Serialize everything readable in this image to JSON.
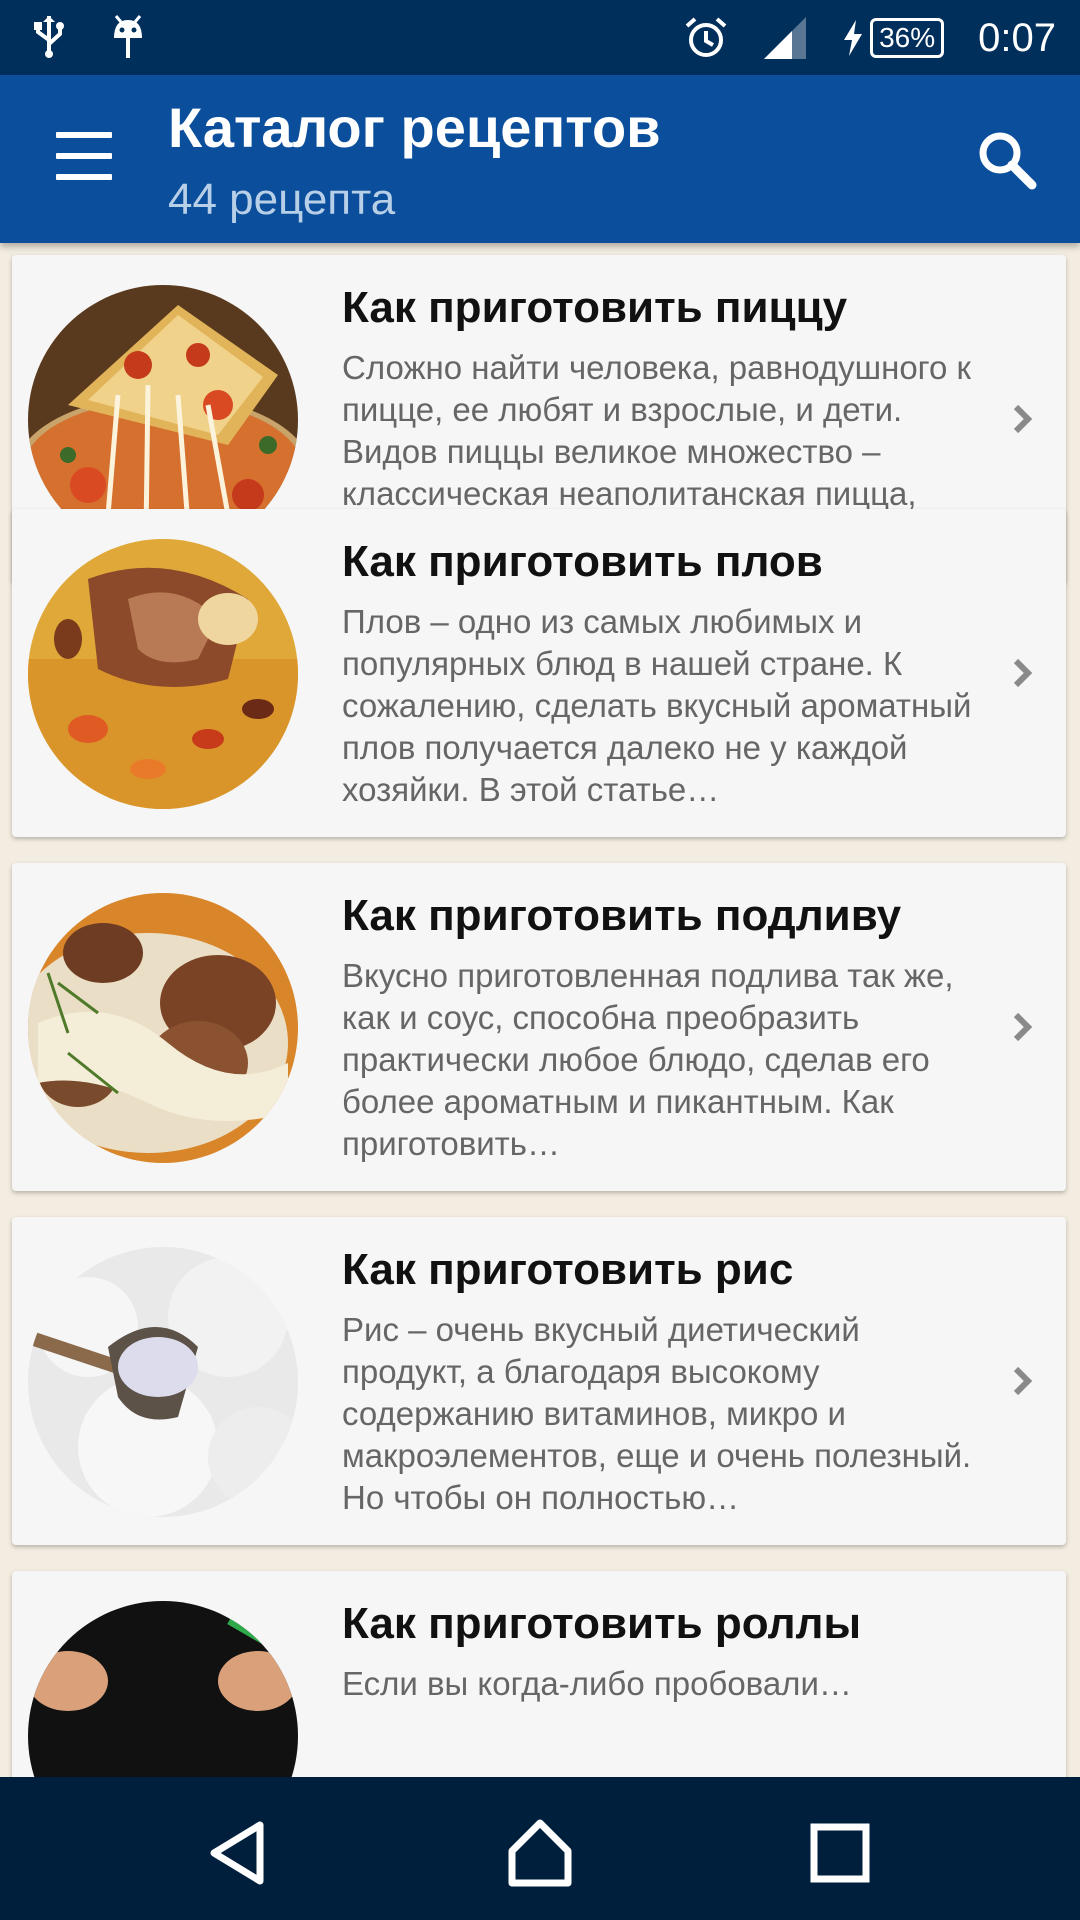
{
  "status_bar": {
    "time": "0:07",
    "battery": "36%",
    "icons": [
      "usb-icon",
      "android-debug-icon",
      "alarm-icon",
      "signal-icon",
      "charging-icon",
      "battery-icon"
    ]
  },
  "app_bar": {
    "title": "Каталог рецептов",
    "subtitle": "44 рецепта",
    "menu_icon": "hamburger-menu-icon",
    "search_icon": "search-icon",
    "color": "#0b4f9c"
  },
  "recipes": [
    {
      "title": "Как приготовить пиццу",
      "description": "Сложно найти человека, равнодушного к пицце, ее любят и взрослые, и дети. Видов пиццы великое множество – классическая неаполитанская пицца, пицца…",
      "image": "pizza-image"
    },
    {
      "title": "Как приготовить плов",
      "description": "Плов – одно из самых любимых и популярных блюд в нашей стране. К сожалению, сделать вкусный ароматный плов получается далеко не у каждой хозяйки. В этой статье…",
      "image": "pilaf-image"
    },
    {
      "title": "Как приготовить подливу",
      "description": "Вкусно приготовленная подлива так же, как и соус, способна преобразить практически любое блюдо, сделав его более ароматным и пикантным. Как приготовить…",
      "image": "gravy-image"
    },
    {
      "title": "Как приготовить рис",
      "description": "Рис – очень вкусный диетический продукт, а благодаря высокому содержанию витаминов, микро и макроэлементов, еще и очень полезный. Но чтобы он полностью…",
      "image": "rice-image"
    },
    {
      "title": "Как приготовить роллы",
      "description": "Если вы когда-либо пробовали…",
      "image": "rolls-image"
    }
  ],
  "nav_bar": {
    "buttons": [
      "back-icon",
      "home-icon",
      "recents-icon"
    ]
  }
}
